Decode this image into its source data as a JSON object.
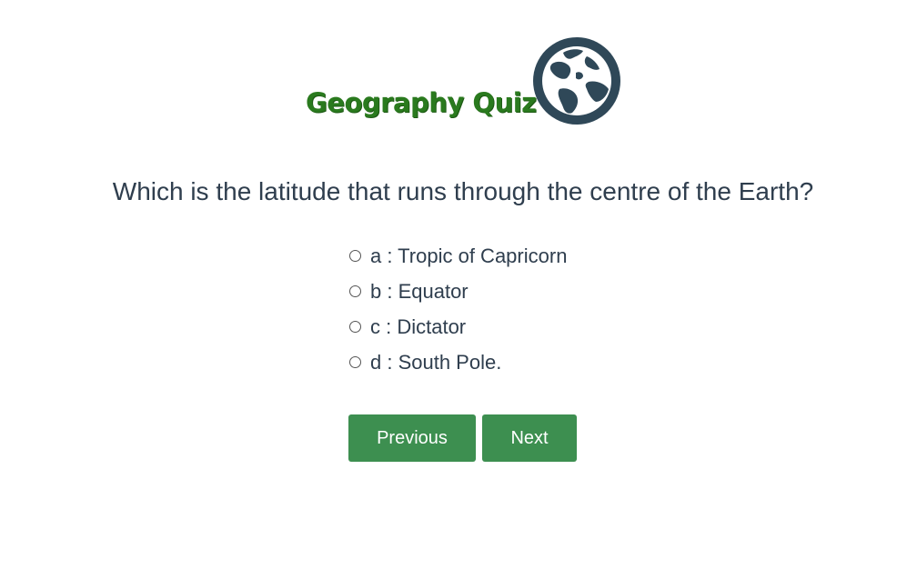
{
  "header": {
    "title": "Geography Quiz",
    "logo_icon": "globe-icon"
  },
  "quiz": {
    "question": "Which is the latitude that runs through the centre of the Earth?",
    "options": [
      {
        "label": "a : Tropic of Capricorn"
      },
      {
        "label": "b : Equator"
      },
      {
        "label": "c : Dictator"
      },
      {
        "label": "d : South Pole."
      }
    ]
  },
  "nav": {
    "previous_label": "Previous",
    "next_label": "Next"
  },
  "colors": {
    "title_green": "#2a7a1e",
    "button_green": "#3d8f50",
    "globe_navy": "#2f4858",
    "text": "#2f3e4e"
  }
}
